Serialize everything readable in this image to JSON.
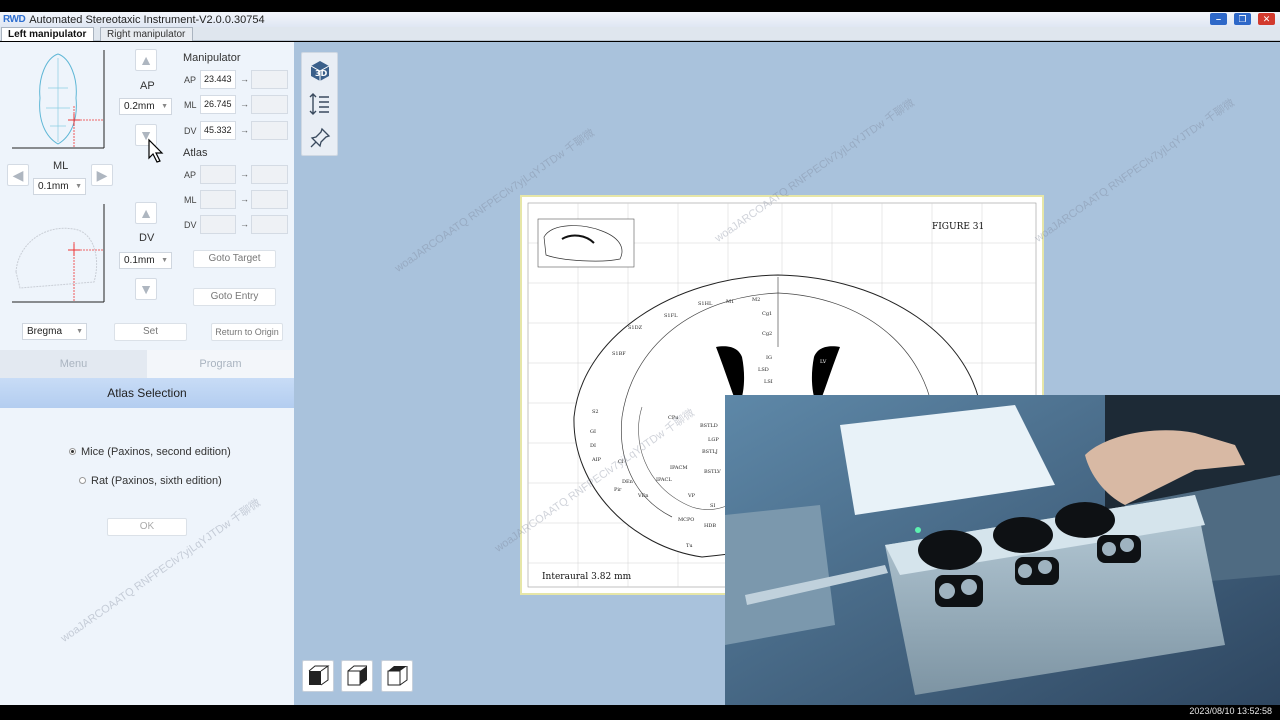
{
  "window": {
    "logo": "RWD",
    "title": "Automated Stereotaxic Instrument-V2.0.0.30754",
    "minimize": "–",
    "maximize": "❐",
    "close": "✕"
  },
  "tabs": {
    "left": "Left manipulator",
    "right": "Right manipulator"
  },
  "controls": {
    "ap_label": "AP",
    "ap_step": "0.2mm",
    "ml_label": "ML",
    "ml_step": "0.1mm",
    "dv_label": "DV",
    "dv_step": "0.1mm",
    "reference": "Bregma"
  },
  "manipulator": {
    "heading": "Manipulator",
    "ap_label": "AP",
    "ap_value": "23.443",
    "ml_label": "ML",
    "ml_value": "26.745",
    "dv_label": "DV",
    "dv_value": "45.332",
    "arrow": "→"
  },
  "atlas_coords": {
    "heading": "Atlas",
    "ap_label": "AP",
    "ml_label": "ML",
    "dv_label": "DV",
    "arrow": "→"
  },
  "buttons": {
    "goto_target": "Goto Target",
    "goto_entry": "Goto Entry",
    "set": "Set",
    "return_origin": "Return to Origin",
    "ok": "OK"
  },
  "bottom_tabs": {
    "menu": "Menu",
    "program": "Program"
  },
  "atlas_selection": {
    "heading": "Atlas Selection",
    "options": [
      {
        "label": "Mice (Paxinos, second edition)",
        "selected": true
      },
      {
        "label": "Rat (Paxinos, sixth edition)",
        "selected": false
      }
    ]
  },
  "atlas_figure": {
    "figure_label": "FIGURE 31",
    "interaural": "Interaural 3.82 mm",
    "regions": [
      "S1HL",
      "M1",
      "M2",
      "S1FL",
      "Cg1",
      "Cg2",
      "S1DZ",
      "S1BF",
      "LV",
      "IG",
      "LSD",
      "LSI",
      "CPu",
      "BSTLD",
      "LGP",
      "BSTLJ",
      "IPACM",
      "IPACL",
      "BSTLV",
      "VP",
      "SI",
      "MCPO",
      "HDB",
      "Tu",
      "S2",
      "GI",
      "DI",
      "AIP",
      "Pir",
      "DEn",
      "VEn",
      "Cl"
    ]
  },
  "tool_icons": [
    "3d-view-icon",
    "depth-scale-icon",
    "pin-icon"
  ],
  "view_buttons": [
    "front-view-icon",
    "side-view-icon",
    "top-view-icon"
  ],
  "status": {
    "timestamp": "2023/08/10 13:52:58"
  },
  "watermark": "woaJARCOAATQ RNFPEClv7yjLqYJTDw 千聊微"
}
